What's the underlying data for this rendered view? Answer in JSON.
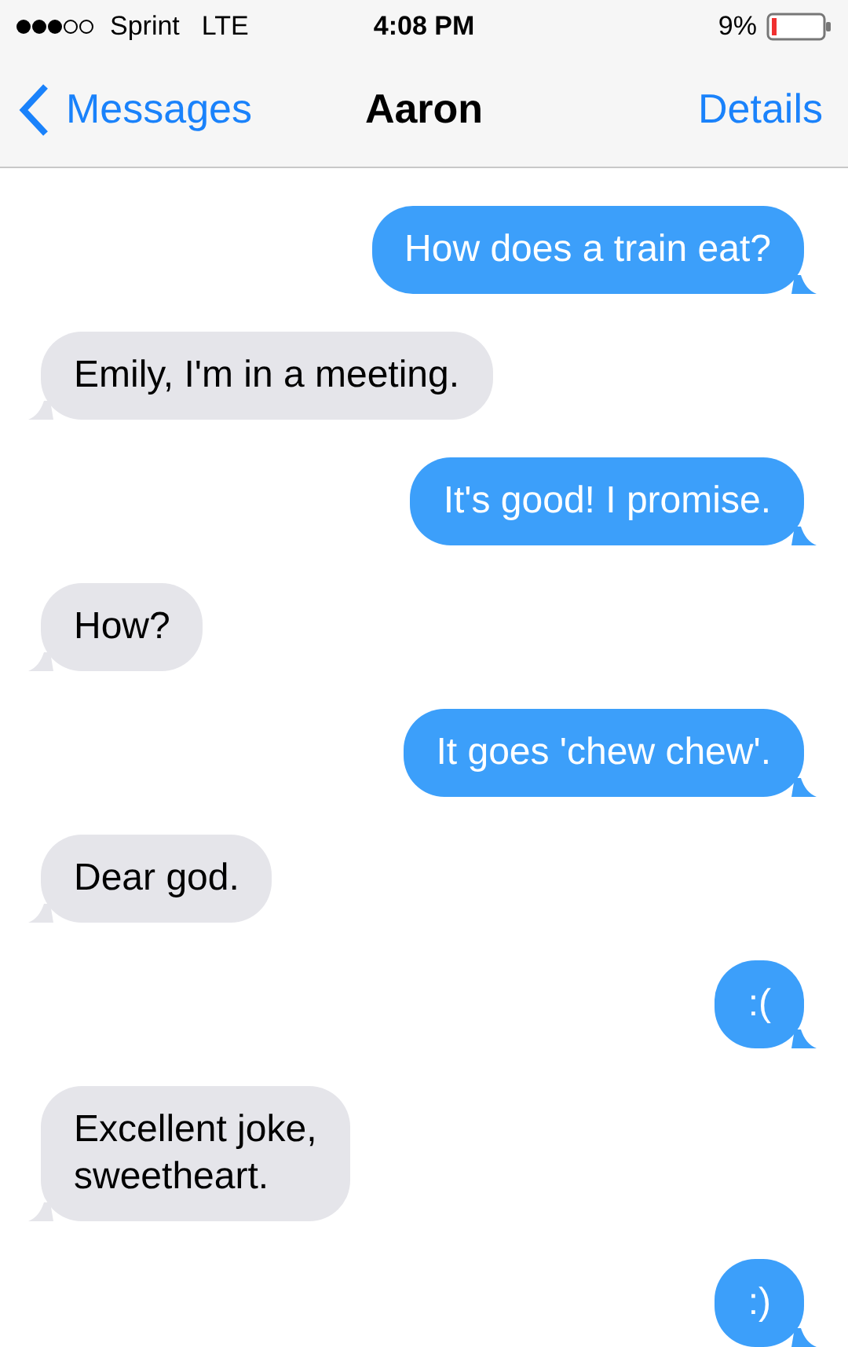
{
  "status_bar": {
    "carrier": "Sprint",
    "network": "LTE",
    "time": "4:08 PM",
    "battery": "9%"
  },
  "nav": {
    "back": "Messages",
    "title": "Aaron",
    "action": "Details"
  },
  "messages": [
    {
      "kind": "sent",
      "text": "How does a train eat?"
    },
    {
      "kind": "received",
      "text": "Emily, I'm in a meeting."
    },
    {
      "kind": "sent",
      "text": "It's good! I promise."
    },
    {
      "kind": "received",
      "text": "How?"
    },
    {
      "kind": "sent",
      "text": "It goes 'chew chew'."
    },
    {
      "kind": "received",
      "text": "Dear god."
    },
    {
      "kind": "sent",
      "text": ":("
    },
    {
      "kind": "received",
      "text": "Excellent joke,\nsweetheart."
    },
    {
      "kind": "sent",
      "text": ":)"
    }
  ]
}
